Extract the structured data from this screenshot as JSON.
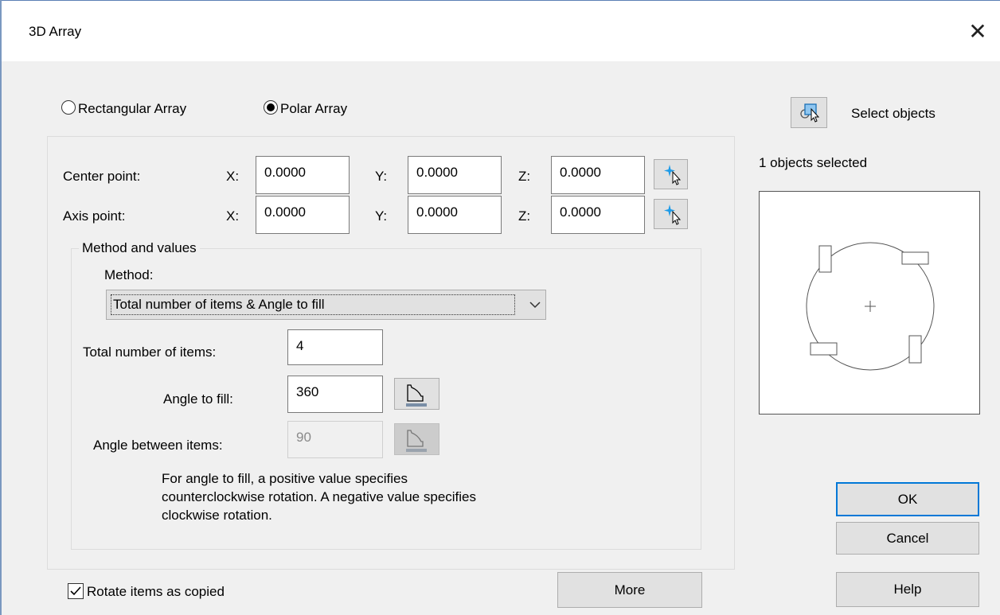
{
  "window": {
    "title": "3D Array",
    "close_symbol": "✕"
  },
  "array_type": {
    "rectangular_label": "Rectangular Array",
    "polar_label": "Polar Array",
    "selected": "polar"
  },
  "center_point": {
    "label": "Center point:",
    "x_label": "X:",
    "x": "0.0000",
    "y_label": "Y:",
    "y": "0.0000",
    "z_label": "Z:",
    "z": "0.0000",
    "pick_icon": "pick-point-icon"
  },
  "axis_point": {
    "label": "Axis point:",
    "x_label": "X:",
    "x": "0.0000",
    "y_label": "Y:",
    "y": "0.0000",
    "z_label": "Z:",
    "z": "0.0000",
    "pick_icon": "pick-point-icon"
  },
  "method_group": {
    "title": "Method and values",
    "method_label": "Method:",
    "method_value": "Total number of items & Angle to fill",
    "total_items_label": "Total number of items:",
    "total_items": "4",
    "angle_fill_label": "Angle to fill:",
    "angle_fill": "360",
    "angle_between_label": "Angle between items:",
    "angle_between": "90",
    "note": "For angle to fill, a positive value specifies counterclockwise rotation. A negative value specifies clockwise rotation."
  },
  "rotate_items": {
    "label": "Rotate items as copied",
    "checked": true
  },
  "more_button": "More",
  "select_objects": {
    "label": "Select objects",
    "icon": "select-objects-icon",
    "status": "1 objects selected"
  },
  "buttons": {
    "ok": "OK",
    "cancel": "Cancel",
    "help": "Help"
  },
  "colors": {
    "accent": "#0078d7",
    "pick_star": "#1e9be8"
  }
}
